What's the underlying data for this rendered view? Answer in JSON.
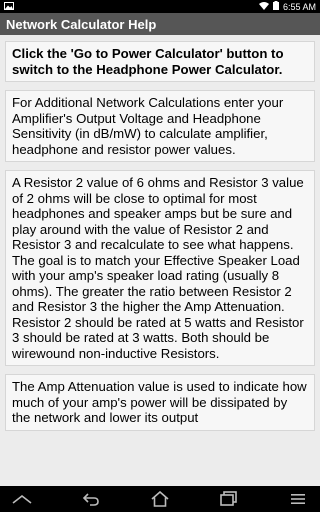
{
  "status": {
    "time": "6:55 AM"
  },
  "actionbar": {
    "title": "Network Calculator Help"
  },
  "cards": [
    "Click the 'Go to Power Calculator' button to switch to the Headphone Power Calculator.",
    "For Additional Network Calculations enter your Amplifier's Output Voltage and Headphone Sensitivity (in dB/mW) to calculate amplifier, headphone and resistor power values.",
    "A Resistor 2 value of 6 ohms and Resistor 3 value of 2 ohms will be close to optimal for most headphones and speaker amps but be sure and play around with the value of Resistor 2 and Resistor 3 and recalculate to see what happens. The goal is to match your Effective Speaker Load with your amp's speaker load rating (usually 8 ohms). The greater the ratio between Resistor 2 and Resistor 3 the higher the Amp Attenuation. Resistor 2 should be rated at 5 watts and Resistor 3 should be rated at 3 watts. Both should be wirewound non-inductive Resistors.",
    "The Amp Attenuation value is used to indicate how much of your amp's power will be dissipated by the network and lower its output"
  ],
  "icons": {
    "notification": "image-notification-icon",
    "wifi": "wifi-icon",
    "battery": "battery-icon",
    "nav_up": "chevron-up-icon",
    "nav_back": "back-icon",
    "nav_home": "home-icon",
    "nav_recents": "recent-apps-icon",
    "nav_menu": "menu-icon"
  }
}
